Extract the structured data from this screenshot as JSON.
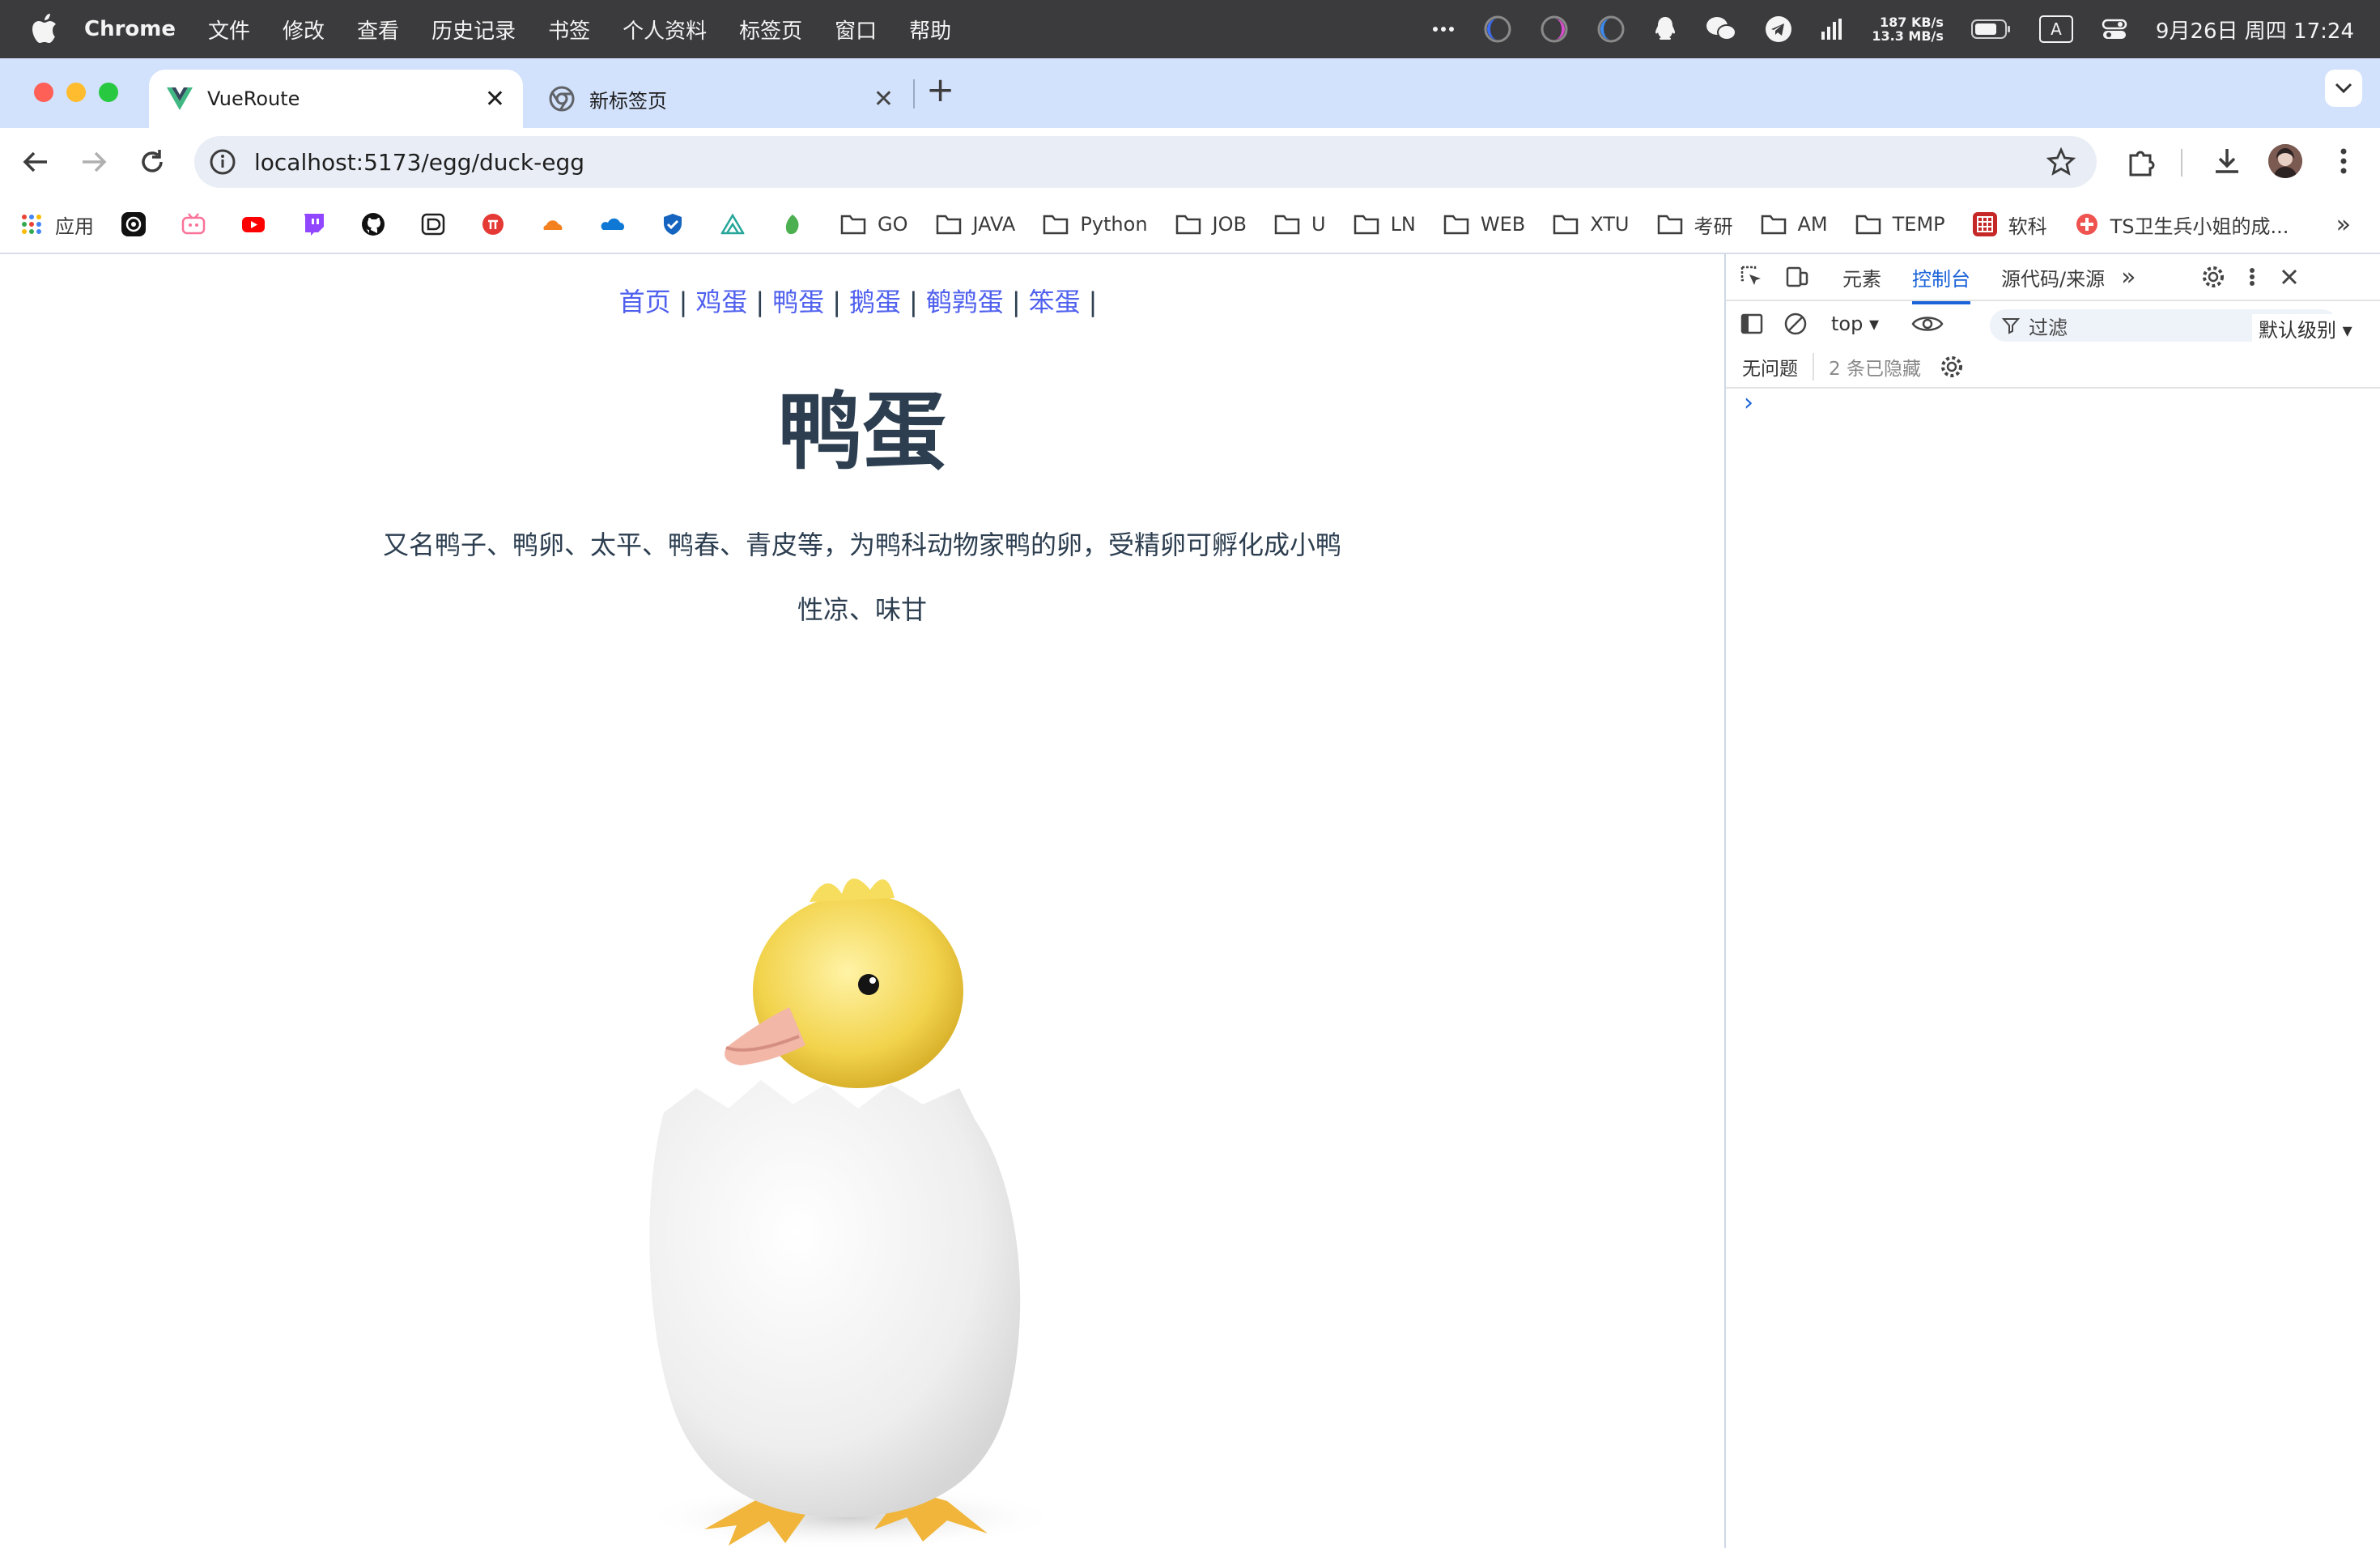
{
  "menubar": {
    "app_name": "Chrome",
    "items": [
      "文件",
      "修改",
      "查看",
      "历史记录",
      "书签",
      "个人资料",
      "标签页",
      "窗口",
      "帮助"
    ],
    "net_up": "187 KB/s",
    "net_down": "13.3 MB/s",
    "input_method": "A",
    "datetime": "9月26日 周四  17:24"
  },
  "tabs": [
    {
      "title": "VueRoute",
      "active": true,
      "icon": "vue-icon"
    },
    {
      "title": "新标签页",
      "active": false,
      "icon": "chrome-icon"
    }
  ],
  "toolbar": {
    "url": "localhost:5173/egg/duck-egg"
  },
  "bookmarks": {
    "apps_label": "应用",
    "folders": [
      "GO",
      "JAVA",
      "Python",
      "JOB",
      "U",
      "LN",
      "WEB",
      "XTU",
      "考研",
      "AM",
      "TEMP"
    ],
    "ruanke_label": "软科",
    "last_label": "TS卫生兵小姐的成..."
  },
  "page": {
    "nav": [
      "首页",
      "鸡蛋",
      "鸭蛋",
      "鹅蛋",
      "鹌鹑蛋",
      "笨蛋"
    ],
    "nav_separator": "|",
    "title": "鸭蛋",
    "description": "又名鸭子、鸭卵、太平、鸭春、青皮等，为鸭科动物家鸭的卵，受精卵可孵化成小鸭",
    "taste": "性凉、味甘"
  },
  "devtools": {
    "tabs": [
      "元素",
      "控制台",
      "源代码/来源"
    ],
    "active_tab": "控制台",
    "context": "top",
    "filter_placeholder": "过滤",
    "level": "默认级别",
    "issues": "无问题",
    "hidden": "2 条已隐藏",
    "prompt": "›"
  },
  "colors": {
    "link": "#4f60ee",
    "heading": "#2c3e50",
    "devtools_accent": "#1a63d8",
    "tabstrip": "#d3e2fc"
  }
}
